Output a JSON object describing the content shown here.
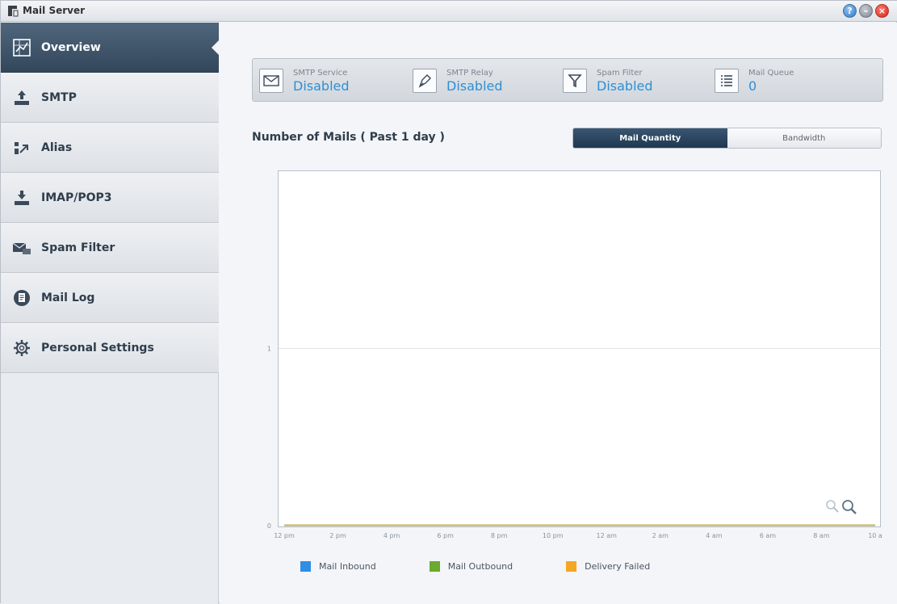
{
  "window": {
    "title": "Mail Server"
  },
  "sidebar": {
    "items": [
      {
        "label": "Overview",
        "icon": "overview-chart-icon",
        "active": true
      },
      {
        "label": "SMTP",
        "icon": "upload-tray-icon"
      },
      {
        "label": "Alias",
        "icon": "alias-arrow-icon"
      },
      {
        "label": "IMAP/POP3",
        "icon": "download-tray-icon"
      },
      {
        "label": "Spam Filter",
        "icon": "spam-mail-icon"
      },
      {
        "label": "Mail Log",
        "icon": "log-document-icon"
      },
      {
        "label": "Personal Settings",
        "icon": "gear-icon"
      }
    ]
  },
  "status": [
    {
      "label": "SMTP Service",
      "value": "Disabled",
      "icon": "envelope-icon"
    },
    {
      "label": "SMTP Relay",
      "value": "Disabled",
      "icon": "relay-pen-icon"
    },
    {
      "label": "Spam Filter",
      "value": "Disabled",
      "icon": "funnel-icon"
    },
    {
      "label": "Mail Queue",
      "value": "0",
      "icon": "list-icon"
    }
  ],
  "section_title": "Number of Mails ( Past 1 day )",
  "toggle": {
    "options": [
      "Mail Quantity",
      "Bandwidth"
    ],
    "selected": "Mail Quantity"
  },
  "colors": {
    "accent": "#2d8fd6",
    "active_nav": "#3a4f64",
    "inbound": "#2f8ee5",
    "outbound": "#6aaa2e",
    "failed": "#f5a623"
  },
  "chart_data": {
    "type": "line",
    "x": [
      "12 pm",
      "2 pm",
      "4 pm",
      "6 pm",
      "8 pm",
      "10 pm",
      "12 am",
      "2 am",
      "4 am",
      "6 am",
      "8 am",
      "10 a"
    ],
    "yticks": [
      "0",
      "1"
    ],
    "ylim": [
      0,
      2
    ],
    "series": [
      {
        "name": "Mail Inbound",
        "values": [
          0,
          0,
          0,
          0,
          0,
          0,
          0,
          0,
          0,
          0,
          0,
          0
        ],
        "color": "#2f8ee5"
      },
      {
        "name": "Mail Outbound",
        "values": [
          0,
          0,
          0,
          0,
          0,
          0,
          0,
          0,
          0,
          0,
          0,
          0
        ],
        "color": "#6aaa2e"
      },
      {
        "name": "Delivery Failed",
        "values": [
          0,
          0,
          0,
          0,
          0,
          0,
          0,
          0,
          0,
          0,
          0,
          0
        ],
        "color": "#f5a623"
      }
    ],
    "grid": true
  },
  "legend": [
    "Mail Inbound",
    "Mail Outbound",
    "Delivery Failed"
  ]
}
